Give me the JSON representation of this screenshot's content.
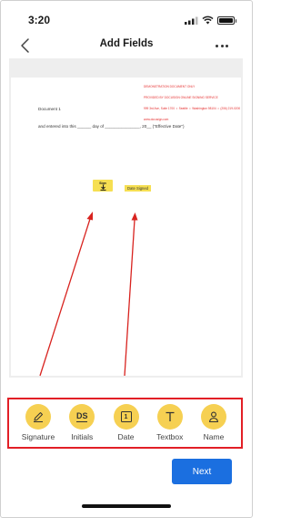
{
  "status_bar": {
    "time": "3:20"
  },
  "nav": {
    "title": "Add Fields"
  },
  "document": {
    "watermark_lines": [
      "DEMONSTRATION DOCUMENT ONLY",
      "PROVIDED BY DOCUSIGN ONLINE SIGNING SERVICE",
      "999 3rd Ave, Suite 1700  •  Seattle  •  Washington 98104  •  (206) 219-0200",
      "www.docusign.com"
    ],
    "heading": "Document 1",
    "body_line": "and entered into this ______ day of _______________, 20__ (\"Effective Date\")",
    "signature_field_label": "Sign",
    "date_field_label": "Date Signed"
  },
  "toolbar": {
    "items": [
      {
        "label": "Signature",
        "icon": "pen-icon"
      },
      {
        "label": "Initials",
        "icon": "initials-ds-icon",
        "icon_text": "DS"
      },
      {
        "label": "Date",
        "icon": "calendar-icon",
        "icon_text": "1"
      },
      {
        "label": "Textbox",
        "icon": "text-t-icon"
      },
      {
        "label": "Name",
        "icon": "person-icon"
      }
    ]
  },
  "actions": {
    "next_label": "Next"
  },
  "colors": {
    "accent_yellow": "#f6d052",
    "field_yellow": "#f6df52",
    "primary_blue": "#1b6fe0",
    "highlight_red": "#e21f26",
    "watermark_red": "#e53030"
  }
}
